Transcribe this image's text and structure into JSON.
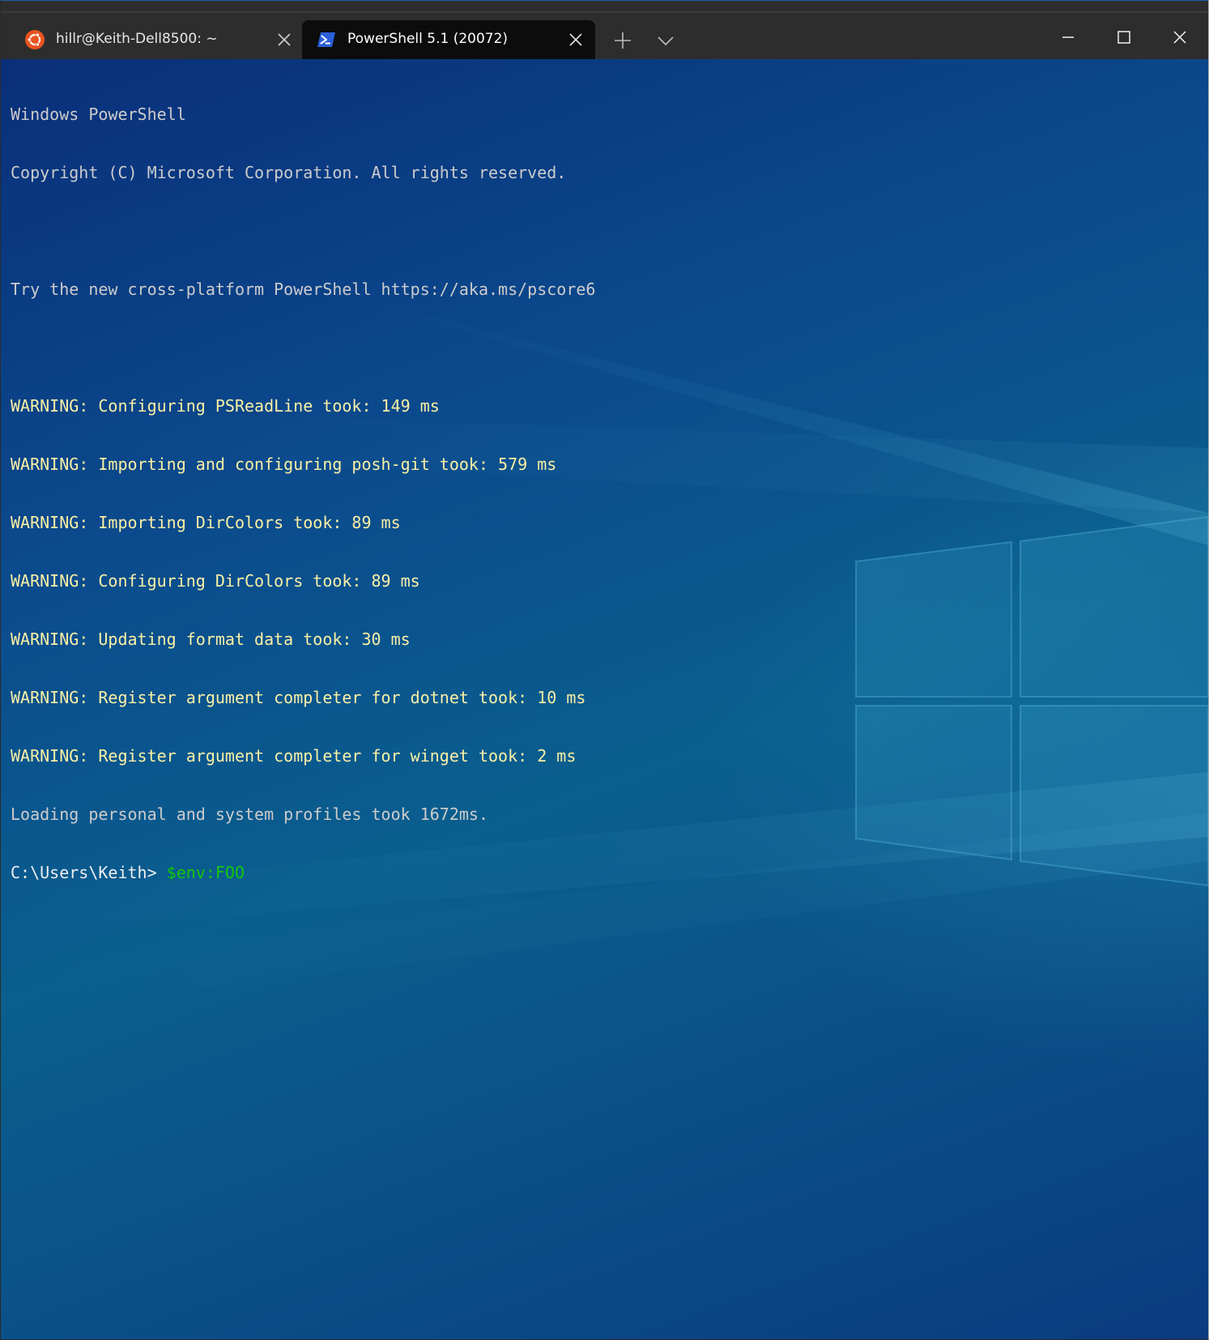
{
  "window": {
    "tabs": [
      {
        "title": "hillr@Keith-Dell8500: ~",
        "icon": "ubuntu-icon",
        "active": false
      },
      {
        "title": "PowerShell 5.1 (20072)",
        "icon": "powershell-icon",
        "active": true
      }
    ],
    "colors": {
      "titlebar": "#2d2d2d",
      "active_tab": "#0c0c0c",
      "ubuntu_orange": "#e95420",
      "powershell_blue": "#2b5fd9",
      "warning_text": "#f9f1a5",
      "command_text": "#16c60c"
    }
  },
  "terminal": {
    "header": [
      "Windows PowerShell",
      "Copyright (C) Microsoft Corporation. All rights reserved.",
      "",
      "Try the new cross-platform PowerShell https://aka.ms/pscore6",
      ""
    ],
    "warnings": [
      "WARNING: Configuring PSReadLine took: 149 ms",
      "WARNING: Importing and configuring posh-git took: 579 ms",
      "WARNING: Importing DirColors took: 89 ms",
      "WARNING: Configuring DirColors took: 89 ms",
      "WARNING: Updating format data took: 30 ms",
      "WARNING: Register argument completer for dotnet took: 10 ms",
      "WARNING: Register argument completer for winget took: 2 ms"
    ],
    "profile_line": "Loading personal and system profiles took 1672ms.",
    "prompt": "C:\\Users\\Keith> ",
    "command": "$env:FOO"
  }
}
